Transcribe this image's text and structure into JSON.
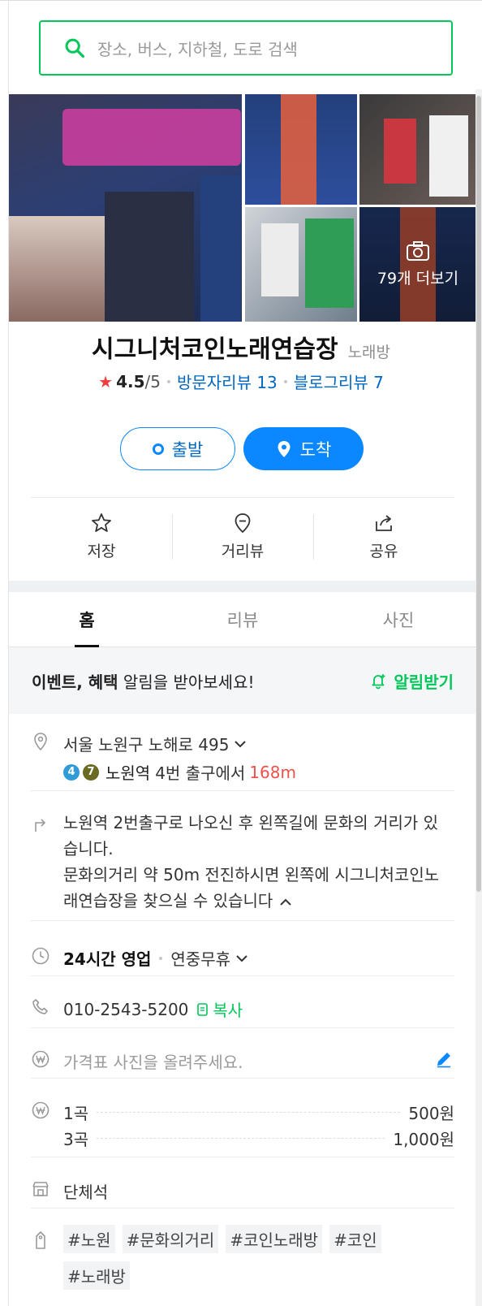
{
  "search": {
    "placeholder": "장소, 버스, 지하철, 도로 검색"
  },
  "photos": {
    "more_label": "79개 더보기"
  },
  "place": {
    "name": "시그니처코인노래연습장",
    "category": "노래방",
    "rating": "4.5",
    "rating_max": "/5",
    "visitor_review_label": "방문자리뷰 13",
    "blog_review_label": "블로그리뷰 7"
  },
  "route_buttons": {
    "start_label": "출발",
    "arrive_label": "도착"
  },
  "actions": [
    {
      "label": "저장",
      "icon": "star-icon"
    },
    {
      "label": "거리뷰",
      "icon": "streetview-pin-icon"
    },
    {
      "label": "공유",
      "icon": "share-icon"
    }
  ],
  "tabs": [
    {
      "label": "홈",
      "active": true
    },
    {
      "label": "리뷰",
      "active": false
    },
    {
      "label": "사진",
      "active": false
    }
  ],
  "notice": {
    "bold": "이벤트, 혜택",
    "text": " 알림을 받아보세요!",
    "button_label": "알림받기"
  },
  "info": {
    "address": "서울 노원구 노해로 495",
    "subway": {
      "line_badges": [
        {
          "num": "4",
          "color": "#2f9bd7"
        },
        {
          "num": "7",
          "color": "#6b6a23"
        }
      ],
      "station": "노원역",
      "exit_text": "4번 출구에서",
      "distance": "168m"
    },
    "directions": "노원역 2번출구로 나오신 후 왼쪽길에 문화의 거리가 있습니다.\n문화의거리 약 50m 전진하시면 왼쪽에 시그니처코인노래연습장을 찾으실 수 있습니다",
    "hours_bold": "24시간 영업",
    "hours_extra": "연중무휴",
    "phone": "010-2543-5200",
    "copy_label": "복사",
    "price_photo_prompt": "가격표 사진을 올려주세요.",
    "menu": [
      {
        "name": "1곡",
        "price": "500원"
      },
      {
        "name": "3곡",
        "price": "1,000원"
      }
    ],
    "facility": "단체석",
    "tags": [
      "#노원",
      "#문화의거리",
      "#코인노래방",
      "#코인",
      "#노래방"
    ]
  },
  "colors": {
    "accent_green": "#03c75a",
    "primary_blue": "#0b87ff",
    "link_blue": "#0068c3",
    "distance_red": "#f0504a"
  }
}
